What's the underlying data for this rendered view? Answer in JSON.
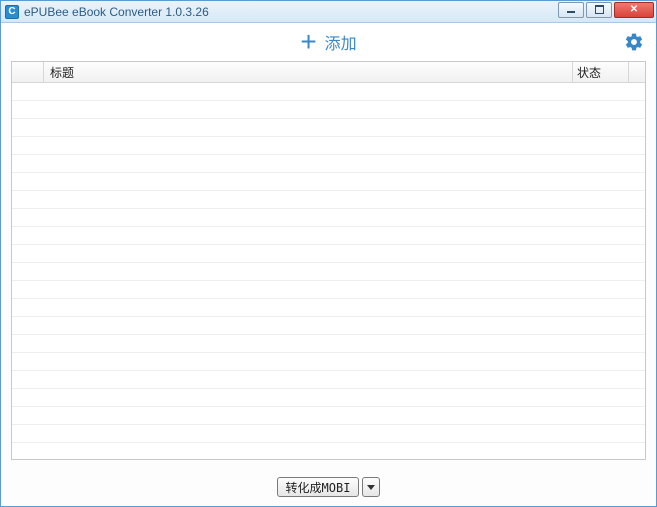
{
  "window": {
    "title": "ePUBee eBook Converter 1.0.3.26",
    "icon_letter": "C"
  },
  "toolbar": {
    "add_label": "添加"
  },
  "table": {
    "col_number": "",
    "col_title": "标题",
    "col_status": "状态",
    "rows": []
  },
  "bottom": {
    "convert_label": "转化成MOBI"
  }
}
